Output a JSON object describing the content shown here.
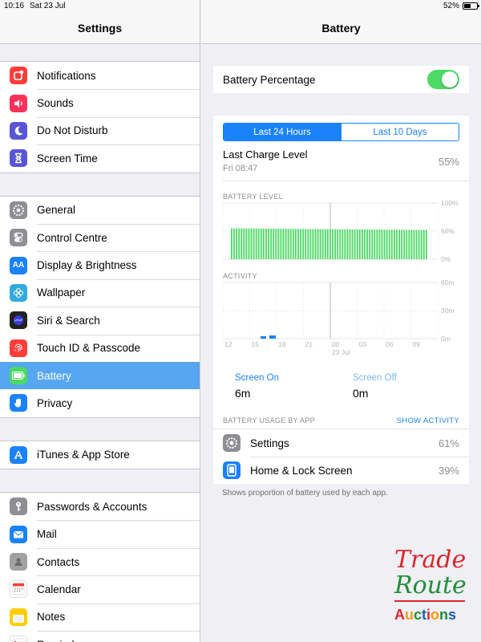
{
  "status": {
    "time": "10:16",
    "date": "Sat 23 Jul",
    "battery": "52%"
  },
  "left": {
    "title": "Settings",
    "groups": [
      [
        {
          "label": "Notifications",
          "color": "#fc3d39",
          "icon": "notifications-icon"
        },
        {
          "label": "Sounds",
          "color": "#fc3159",
          "icon": "speaker-icon"
        },
        {
          "label": "Do Not Disturb",
          "color": "#5856d6",
          "icon": "moon-icon"
        },
        {
          "label": "Screen Time",
          "color": "#5856d6",
          "icon": "hourglass-icon"
        }
      ],
      [
        {
          "label": "General",
          "color": "#8e8e93",
          "icon": "gear-icon"
        },
        {
          "label": "Control Centre",
          "color": "#8e8e93",
          "icon": "toggles-icon"
        },
        {
          "label": "Display & Brightness",
          "color": "#1a82fb",
          "icon": "text-size-icon"
        },
        {
          "label": "Wallpaper",
          "color": "#34aadc",
          "icon": "flower-icon"
        },
        {
          "label": "Siri & Search",
          "color": "#222222",
          "icon": "siri-icon"
        },
        {
          "label": "Touch ID & Passcode",
          "color": "#fc3d39",
          "icon": "fingerprint-icon"
        },
        {
          "label": "Battery",
          "color": "#4cd964",
          "icon": "battery-icon",
          "selected": true
        },
        {
          "label": "Privacy",
          "color": "#1a82fb",
          "icon": "hand-icon"
        }
      ],
      [
        {
          "label": "iTunes & App Store",
          "color": "#1a82fb",
          "icon": "app-store-icon"
        }
      ],
      [
        {
          "label": "Passwords & Accounts",
          "color": "#8e8e93",
          "icon": "key-icon"
        },
        {
          "label": "Mail",
          "color": "#1a82fb",
          "icon": "mail-icon"
        },
        {
          "label": "Contacts",
          "color": "#a2a2a2",
          "icon": "contacts-icon"
        },
        {
          "label": "Calendar",
          "color": "#ffffff",
          "icon": "calendar-icon"
        },
        {
          "label": "Notes",
          "color": "#ffcc00",
          "icon": "notes-icon"
        },
        {
          "label": "Reminders",
          "color": "#ffffff",
          "icon": "reminders-icon"
        }
      ]
    ]
  },
  "right": {
    "title": "Battery",
    "percentage_label": "Battery Percentage",
    "percentage_on": true,
    "segments": [
      "Last 24 Hours",
      "Last 10 Days"
    ],
    "last_charge": {
      "label": "Last Charge Level",
      "time": "Fri 08:47",
      "value": "55%"
    },
    "battery_level": {
      "label": "BATTERY LEVEL",
      "y_ticks": [
        "100%",
        "50%",
        "0%"
      ],
      "bar_count": 80,
      "level": 0.55,
      "color": "#4cd964"
    },
    "activity": {
      "label": "ACTIVITY",
      "y_ticks": [
        "60m",
        "30m",
        "0m"
      ],
      "x_ticks": [
        "12",
        "15",
        "18",
        "21",
        "00",
        "03",
        "06",
        "09"
      ],
      "x_sub": "23 Jul",
      "color": "#1a82fb"
    },
    "screen_on": {
      "label": "Screen On",
      "value": "6m"
    },
    "screen_off": {
      "label": "Screen Off",
      "value": "0m"
    },
    "usage_label": "BATTERY USAGE BY APP",
    "show_activity": "SHOW ACTIVITY",
    "apps": [
      {
        "name": "Settings",
        "value": "61%"
      },
      {
        "name": "Home & Lock Screen",
        "value": "39%"
      }
    ],
    "footnote": "Shows proportion of battery used by each app."
  },
  "watermark": {
    "line1": "Trade",
    "line2": "Route",
    "line3": "Auctions"
  }
}
